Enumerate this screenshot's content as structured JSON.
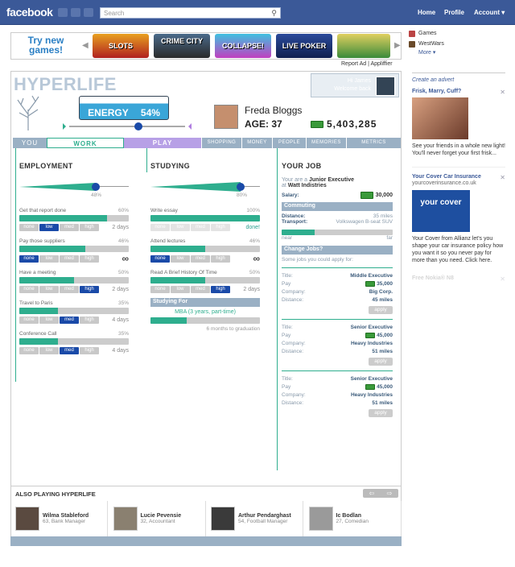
{
  "fb": {
    "logo": "facebook",
    "search_placeholder": "Search",
    "links": [
      "Home",
      "Profile",
      "Account"
    ]
  },
  "banner": {
    "try_new": "Try new games!",
    "games": [
      "SLOTS",
      "CRIME CITY",
      "COLLAPSE!",
      "LIVE POKER",
      ""
    ],
    "report": "Report Ad | Appliffier"
  },
  "right": {
    "apps": [
      "Games",
      "WestWars"
    ],
    "more": "More",
    "create_ad": "Create an advert",
    "ad1": {
      "title": "Frisk, Marry, Cuff?",
      "text": "See your friends in a whole new light! You'll never forget your first frisk..."
    },
    "ad2": {
      "title": "Your Cover Car Insurance",
      "url": "yourcoverinsurance.co.uk",
      "logo": "your cover",
      "text": "Your Cover from Allianz let's you shape your car insurance policy how you want it so you never pay for more than you need. Click here."
    },
    "ad3": {
      "title": "Free Nokia® N8"
    }
  },
  "app": {
    "logo": "HYPERLIFE",
    "greeting": "Hi James",
    "welcome": "Welcome back",
    "energy_label": "ENERGY",
    "energy_pct": "54%",
    "player_name": "Freda Bloggs",
    "age_label": "AGE: 37",
    "money": "5,403,285",
    "tabs": {
      "you": "YOU",
      "work": "WORK",
      "play": "PLAY",
      "shopping": "SHOPPING",
      "money": "MONEY",
      "people": "PEOPLE",
      "memories": "MEMORIES",
      "metrics": "METRICS"
    }
  },
  "employment": {
    "title": "EMPLOYMENT",
    "slider_pct": "48%",
    "slider_level": 0.48,
    "tasks": [
      {
        "name": "Get that report done",
        "pct": "60%",
        "fill": 0.8,
        "option": "low",
        "eta": "2 days"
      },
      {
        "name": "Pay those suppliers",
        "pct": "46%",
        "fill": 0.6,
        "option": "none",
        "eta": "∞"
      },
      {
        "name": "Have a meeting",
        "pct": "50%",
        "fill": 0.5,
        "option": "high",
        "eta": "2 days"
      },
      {
        "name": "Travel to Paris",
        "pct": "35%",
        "fill": 0.35,
        "option": "med",
        "eta": "4 days"
      },
      {
        "name": "Conference Call",
        "pct": "35%",
        "fill": 0.35,
        "option": "med",
        "eta": "4 days"
      }
    ],
    "options": [
      "none",
      "low",
      "med",
      "high"
    ]
  },
  "studying": {
    "title": "STUDYING",
    "slider_pct": "80%",
    "slider_level": 0.8,
    "tasks": [
      {
        "name": "Write essay",
        "pct": "100%",
        "fill": 1.0,
        "option": "",
        "eta": "done!"
      },
      {
        "name": "Attend lectures",
        "pct": "46%",
        "fill": 0.5,
        "option": "none",
        "eta": "∞"
      },
      {
        "name": "Read A Brief History Of Time",
        "pct": "50%",
        "fill": 0.5,
        "option": "high",
        "eta": "2 days"
      }
    ],
    "studying_for_label": "Studying For",
    "studying_for_value": "MBA (3 years, part-time)",
    "graduation": "6 months to graduation",
    "graduation_progress": 0.33
  },
  "job": {
    "title": "YOUR JOB",
    "line1": "Your are a",
    "position": "Junior Executive",
    "at": "at",
    "company": "Watt Indistries",
    "salary_label": "Salary:",
    "salary": "30,000",
    "commuting": "Commuting",
    "distance_label": "Distance:",
    "distance": "35 miles",
    "transport_label": "Transport:",
    "transport": "Volkswagen B-seat SUV",
    "near": "near",
    "far": "far",
    "commute_level": 0.3,
    "change_jobs": "Change Jobs?",
    "some_jobs": "Some jobs you could apply for:",
    "labels": {
      "title": "Title:",
      "pay": "Pay",
      "company": "Company:",
      "distance": "Distance:"
    },
    "apply": "apply",
    "offers": [
      {
        "title": "Middle Executive",
        "pay": "35,000",
        "company": "Big Corp.",
        "distance": "45 miles"
      },
      {
        "title": "Senior Executive",
        "pay": "45,000",
        "company": "Heavy Industries",
        "distance": "51 miles"
      },
      {
        "title": "Senior Executive",
        "pay": "45,000",
        "company": "Heavy Industries",
        "distance": "51 miles"
      }
    ]
  },
  "also": {
    "title": "ALSO PLAYING HYPERLIFE",
    "friends": [
      {
        "name": "Wilma Stableford",
        "sub": "63, Bank Manager"
      },
      {
        "name": "Lucie Pevensie",
        "sub": "32, Accountant"
      },
      {
        "name": "Arthur Pendarghast",
        "sub": "54, Football Manager"
      },
      {
        "name": "Ic Bodlan",
        "sub": "27, Comedian"
      }
    ]
  },
  "colors": {
    "fb_blue": "#3b5998",
    "teal": "#2eae8e",
    "tab_blue": "#9ab0c4",
    "play_purple": "#b7a0e6",
    "selected_option": "#1a4aa8"
  }
}
